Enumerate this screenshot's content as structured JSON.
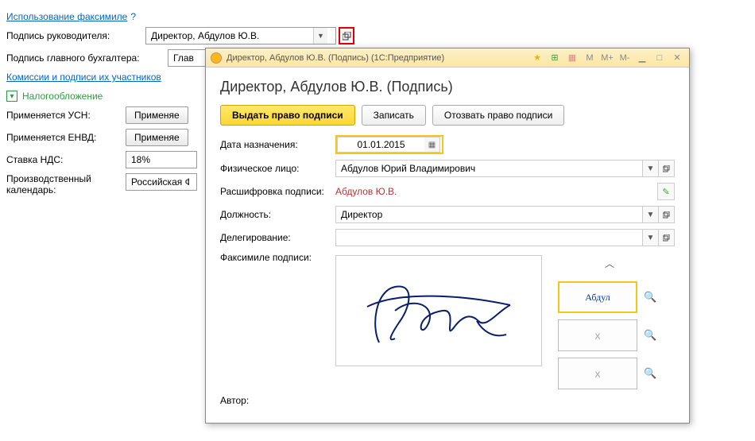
{
  "top": {
    "facsimile_link": "Использование факсимиле",
    "help_icon": "?",
    "manager_sig_label": "Подпись руководителя:",
    "manager_sig_value": "Директор, Абдулов Ю.В.",
    "accountant_sig_label": "Подпись главного бухгалтера:",
    "accountant_sig_value": "Глав",
    "commissions_link": "Комиссии и подписи их участников"
  },
  "section": {
    "taxation": "Налогообложение",
    "usn_label": "Применяется УСН:",
    "usn_btn": "Применяе",
    "envd_label": "Применяется ЕНВД:",
    "envd_btn": "Применяе",
    "vat_label": "Ставка НДС:",
    "vat_value": "18%",
    "calendar_label": "Производственный календарь:",
    "calendar_value": "Российская Ф"
  },
  "modal": {
    "titlebar": "Директор, Абдулов Ю.В. (Подпись)  (1С:Предприятие)",
    "heading": "Директор, Абдулов Ю.В. (Подпись)",
    "btn_issue": "Выдать право подписи",
    "btn_save": "Записать",
    "btn_revoke": "Отозвать право подписи",
    "date_label": "Дата назначения:",
    "date_value": "01.01.2015",
    "person_label": "Физическое лицо:",
    "person_value": "Абдулов Юрий Владимирович",
    "decode_label": "Расшифровка подписи:",
    "decode_value": "Абдулов Ю.В.",
    "position_label": "Должность:",
    "position_value": "Директор",
    "delegation_label": "Делегирование:",
    "delegation_value": "",
    "facsimile_label": "Факсимиле подписи:",
    "author_label": "Автор:",
    "m_buttons": [
      "M",
      "M+",
      "M-"
    ]
  }
}
